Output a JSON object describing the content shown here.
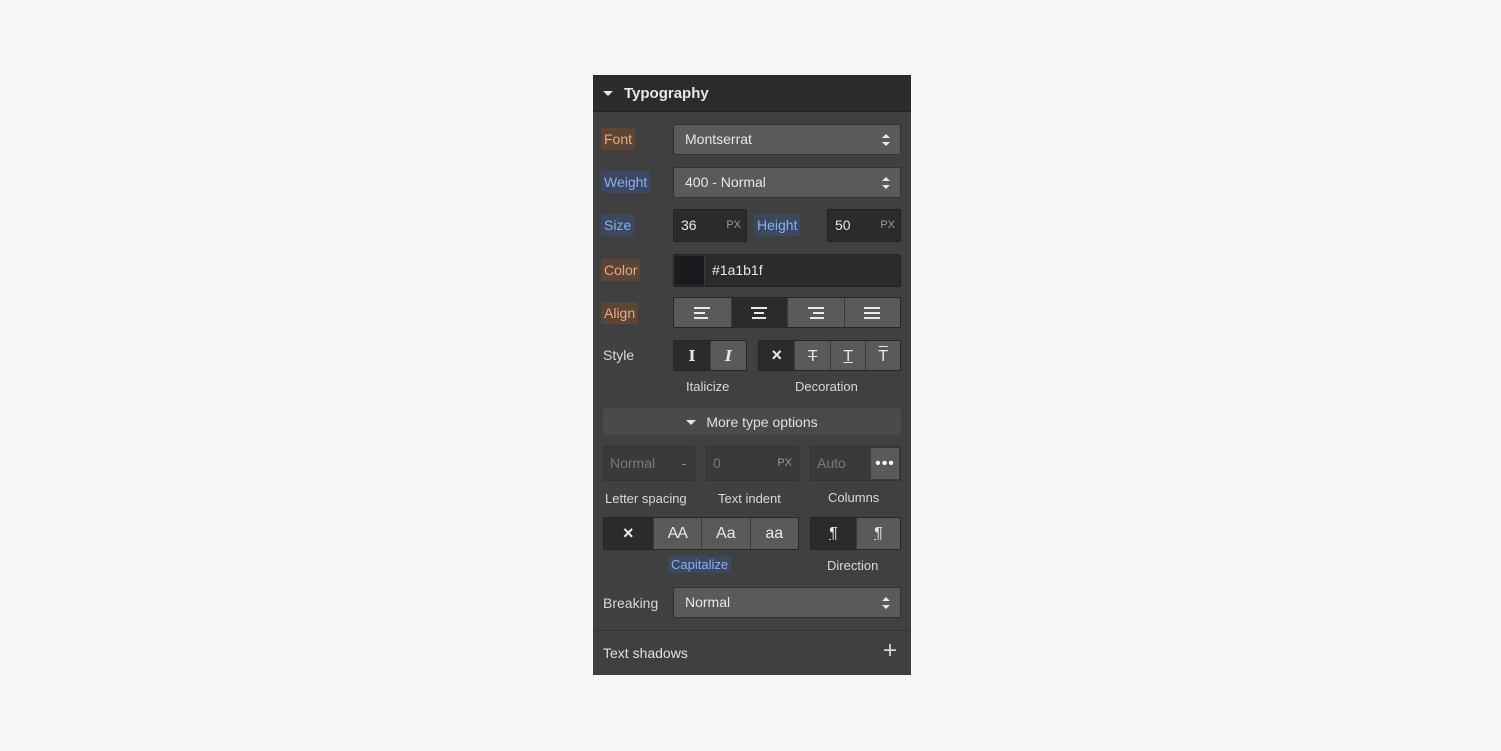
{
  "section": {
    "title": "Typography"
  },
  "font": {
    "label": "Font",
    "value": "Montserrat"
  },
  "weight": {
    "label": "Weight",
    "value": "400 - Normal"
  },
  "size": {
    "label": "Size",
    "value": "36",
    "unit": "PX"
  },
  "height": {
    "label": "Height",
    "value": "50",
    "unit": "PX"
  },
  "color": {
    "label": "Color",
    "value": "#1a1b1f",
    "swatch": "#1a1b1f"
  },
  "align": {
    "label": "Align",
    "options": [
      "left",
      "center",
      "right",
      "justify"
    ],
    "selected": "center"
  },
  "style": {
    "label": "Style",
    "italicize_caption": "Italicize",
    "decoration_caption": "Decoration",
    "italic_options": [
      "I",
      "I"
    ],
    "decoration_options": [
      "×",
      "T",
      "T",
      "T"
    ]
  },
  "more": {
    "label": "More type options"
  },
  "letter_spacing": {
    "value": "Normal",
    "suffix": "-",
    "caption": "Letter spacing"
  },
  "text_indent": {
    "value": "0",
    "unit": "PX",
    "caption": "Text indent"
  },
  "columns": {
    "value": "Auto",
    "more": "•••",
    "caption": "Columns"
  },
  "capitalize": {
    "caption": "Capitalize",
    "options": [
      "×",
      "AA",
      "Aa",
      "aa"
    ]
  },
  "direction": {
    "caption": "Direction",
    "options": [
      "¶",
      "¶"
    ]
  },
  "breaking": {
    "label": "Breaking",
    "value": "Normal"
  },
  "text_shadows": {
    "label": "Text shadows",
    "add": "+"
  }
}
